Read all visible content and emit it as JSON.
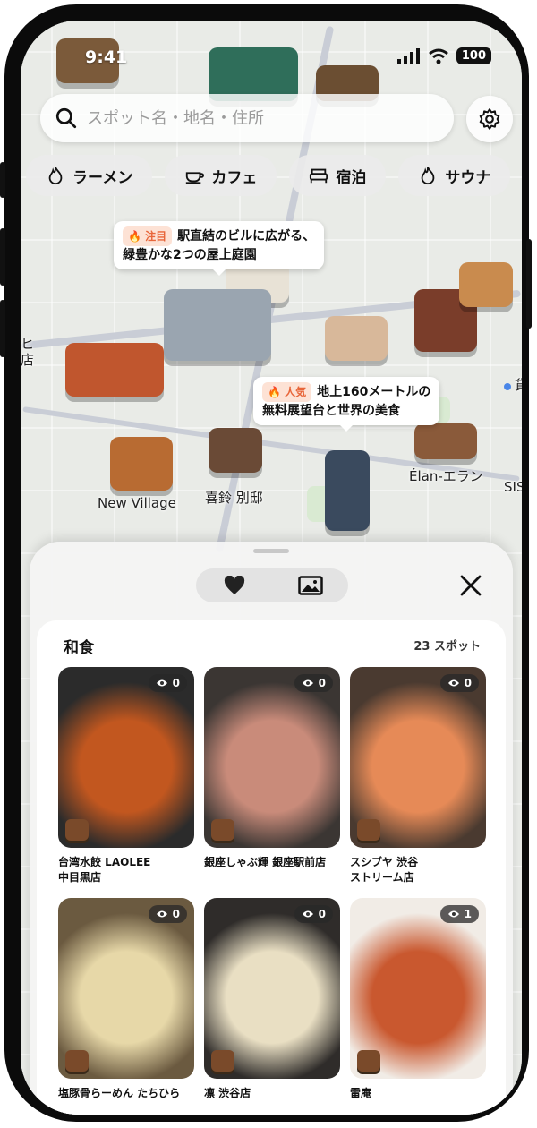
{
  "status": {
    "time": "9:41",
    "battery": "100"
  },
  "search": {
    "placeholder": "スポット名・地名・住所"
  },
  "chips": [
    "ラーメン",
    "カフェ",
    "宿泊",
    "サウナ"
  ],
  "callouts": [
    {
      "badge": "注目",
      "line1": "駅直結のビルに広がる、",
      "line2": "緑豊かな2つの屋上庭園"
    },
    {
      "badge": "人気",
      "line1": "地上160メートルの",
      "line2": "無料展望台と世界の美食"
    }
  ],
  "map_labels": [
    "New Village",
    "喜鈴 別邸",
    "Élan-エラン",
    "SIS",
    "店",
    "ヒ",
    "貸"
  ],
  "sheet": {
    "section_title": "和食",
    "section_count": "23 スポット",
    "cards": [
      {
        "line1": "台湾水餃 LAOLEE",
        "line2": "中目黒店",
        "views": "0",
        "color1": "#c2571f",
        "color2": "#2b2b2b"
      },
      {
        "line1": "銀座しゃぶ輝 銀座駅前店",
        "line2": "",
        "views": "0",
        "color1": "#c98b7a",
        "color2": "#3b3633"
      },
      {
        "line1": "スシブヤ 渋谷",
        "line2": "ストリーム店",
        "views": "0",
        "color1": "#e68a57",
        "color2": "#4a3a30"
      },
      {
        "line1": "塩豚骨らーめん たちひら",
        "line2": "",
        "views": "0",
        "color1": "#e7d8a8",
        "color2": "#6b5a40"
      },
      {
        "line1": "凛 渋谷店",
        "line2": "",
        "views": "0",
        "color1": "#e9dfc3",
        "color2": "#2f2c2a"
      },
      {
        "line1": "雷庵",
        "line2": "",
        "views": "1",
        "color1": "#c9582f",
        "color2": "#f1ece6"
      }
    ]
  }
}
